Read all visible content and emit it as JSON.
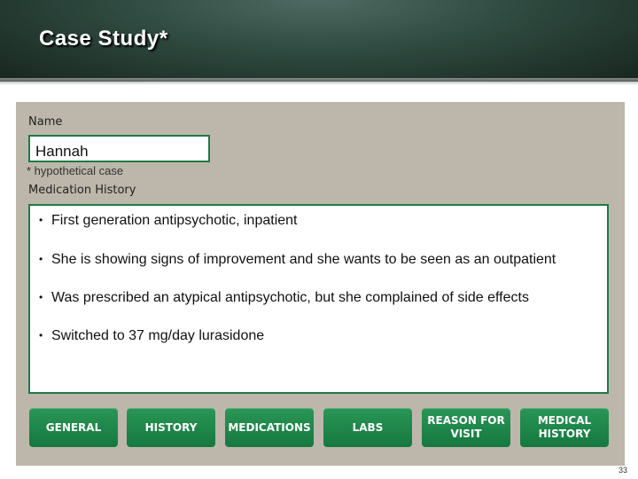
{
  "header": {
    "title": "Case Study*"
  },
  "patient": {
    "name_label": "Name",
    "name_value": "Hannah",
    "footnote": "* hypothetical case"
  },
  "medication_history": {
    "label": "Medication History",
    "items": [
      "First generation antipsychotic, inpatient",
      "She is showing signs of improvement and she wants to be seen as an outpatient",
      "Was prescribed an atypical antipsychotic, but she complained of side effects",
      "Switched to 37 mg/day lurasidone"
    ]
  },
  "nav": {
    "buttons": [
      "GENERAL",
      "HISTORY",
      "MEDICATIONS",
      "LABS",
      "REASON FOR\nVISIT",
      "MEDICAL\nHISTORY"
    ]
  },
  "page_number": "33"
}
